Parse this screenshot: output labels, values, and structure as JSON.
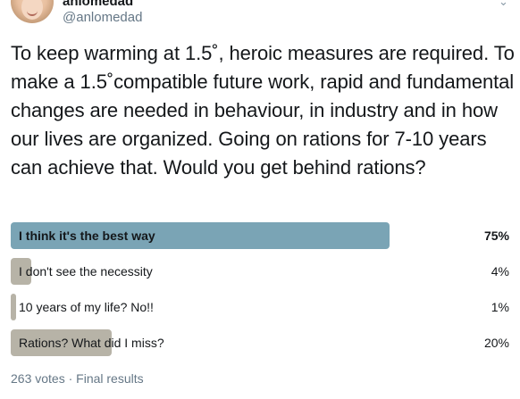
{
  "author": {
    "display_name": "anlomedad",
    "handle": "@anlomedad"
  },
  "tweet": {
    "text": "To keep warming at 1.5˚, heroic measures are required. To make a 1.5˚compatible future work, rapid and fundamental changes are needed in behaviour, in industry and in how our lives are organized. Going on rations for 7-10 years can achieve that. Would you get behind rations?"
  },
  "poll": {
    "options": [
      {
        "label": "I think it's the best way",
        "percent_text": "75%",
        "percent": 75,
        "winner": true
      },
      {
        "label": "I don't see the necessity",
        "percent_text": "4%",
        "percent": 4,
        "winner": false
      },
      {
        "label": "10 years of my life? No!!",
        "percent_text": "1%",
        "percent": 1,
        "winner": false
      },
      {
        "label": "Rations? What did I miss?",
        "percent_text": "20%",
        "percent": 20,
        "winner": false
      }
    ],
    "footer": "263 votes · Final results"
  },
  "colors": {
    "winner_bar": "#7aa4b5",
    "other_bar": "#b7b3a7",
    "secondary_text": "#657786"
  },
  "icons": {
    "menu": "chevron-down-icon"
  }
}
